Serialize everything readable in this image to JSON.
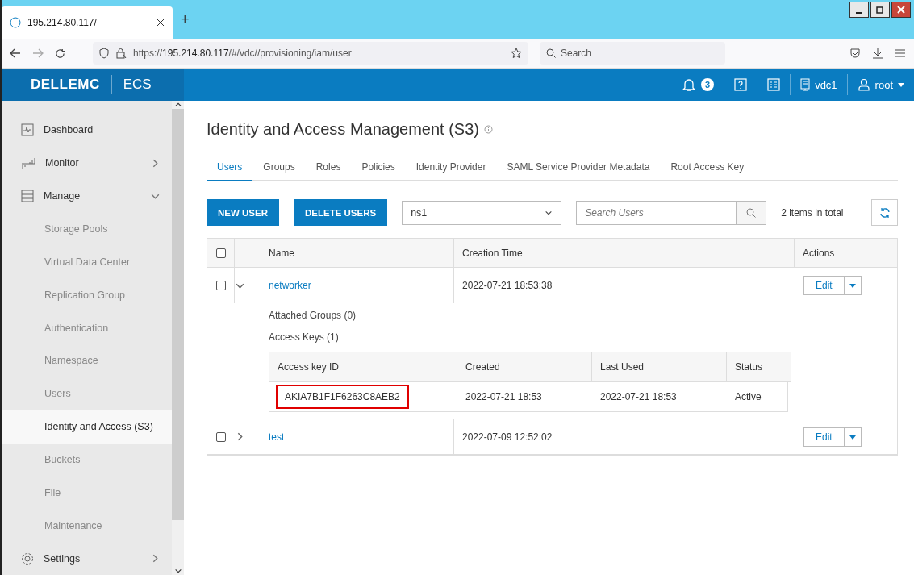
{
  "browser": {
    "tab_title": "195.214.80.117/",
    "new_tab": "+",
    "url_prefix": "https://",
    "url_host": "195.214.80.117",
    "url_path": "/#/vdc//provisioning/iam/user",
    "search_placeholder": "Search"
  },
  "header": {
    "logo_brand": "DELLEMC",
    "product": "ECS",
    "alerts_count": "3",
    "vdc": "vdc1",
    "user": "root"
  },
  "sidebar": {
    "items": [
      {
        "label": "Dashboard",
        "selected": false
      },
      {
        "label": "Monitor",
        "expanded": false,
        "selected": false
      },
      {
        "label": "Manage",
        "expanded": true,
        "selected": false,
        "children": [
          {
            "label": "Storage Pools",
            "selected": false
          },
          {
            "label": "Virtual Data Center",
            "selected": false
          },
          {
            "label": "Replication Group",
            "selected": false
          },
          {
            "label": "Authentication",
            "selected": false
          },
          {
            "label": "Namespace",
            "selected": false
          },
          {
            "label": "Users",
            "selected": false
          },
          {
            "label": "Identity and Access (S3)",
            "selected": true
          },
          {
            "label": "Buckets",
            "selected": false
          },
          {
            "label": "File",
            "selected": false
          },
          {
            "label": "Maintenance",
            "selected": false
          }
        ]
      },
      {
        "label": "Settings",
        "expanded": false,
        "selected": false
      }
    ]
  },
  "page": {
    "title": "Identity and Access Management (S3)",
    "tabs": [
      {
        "label": "Users",
        "selected": true
      },
      {
        "label": "Groups",
        "selected": false
      },
      {
        "label": "Roles",
        "selected": false
      },
      {
        "label": "Policies",
        "selected": false
      },
      {
        "label": "Identity Provider",
        "selected": false
      },
      {
        "label": "SAML Service Provider Metadata",
        "selected": false
      },
      {
        "label": "Root Access Key",
        "selected": false
      }
    ],
    "buttons": [
      "NEW USER",
      "DELETE USERS"
    ],
    "namespace": "ns1",
    "search_placeholder": "Search Users",
    "total": "2 items in total"
  },
  "table": {
    "columns": [
      "Name",
      "Creation Time",
      "Actions"
    ],
    "all_checked": false,
    "rows": [
      {
        "name": "networker",
        "created": "2022-07-21 18:53:38",
        "checked": false,
        "expanded": true,
        "action": "Edit",
        "details": {
          "groups": "Attached Groups (0)",
          "keys_label": "Access Keys (1)",
          "key_columns": [
            "Access key ID",
            "Created",
            "Last Used",
            "Status"
          ],
          "keys": [
            {
              "id": "AKIA7B1F1F6263C8AEB2",
              "created": "2022-07-21 18:53",
              "last_used": "2022-07-21 18:53",
              "status": "Active",
              "highlighted": true
            }
          ]
        }
      },
      {
        "name": "test",
        "created": "2022-07-09 12:52:02",
        "checked": false,
        "expanded": false,
        "action": "Edit"
      }
    ]
  }
}
